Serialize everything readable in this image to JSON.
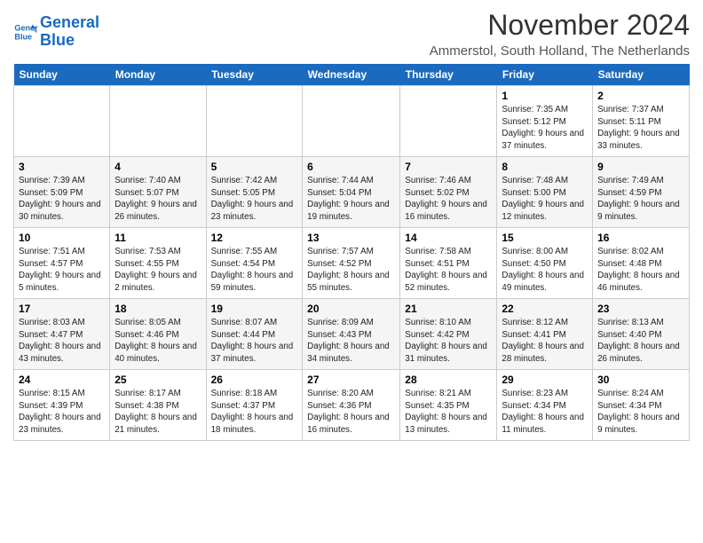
{
  "header": {
    "logo_line1": "General",
    "logo_line2": "Blue",
    "month": "November 2024",
    "location": "Ammerstol, South Holland, The Netherlands"
  },
  "weekdays": [
    "Sunday",
    "Monday",
    "Tuesday",
    "Wednesday",
    "Thursday",
    "Friday",
    "Saturday"
  ],
  "weeks": [
    [
      {
        "day": "",
        "info": ""
      },
      {
        "day": "",
        "info": ""
      },
      {
        "day": "",
        "info": ""
      },
      {
        "day": "",
        "info": ""
      },
      {
        "day": "",
        "info": ""
      },
      {
        "day": "1",
        "info": "Sunrise: 7:35 AM\nSunset: 5:12 PM\nDaylight: 9 hours and 37 minutes."
      },
      {
        "day": "2",
        "info": "Sunrise: 7:37 AM\nSunset: 5:11 PM\nDaylight: 9 hours and 33 minutes."
      }
    ],
    [
      {
        "day": "3",
        "info": "Sunrise: 7:39 AM\nSunset: 5:09 PM\nDaylight: 9 hours and 30 minutes."
      },
      {
        "day": "4",
        "info": "Sunrise: 7:40 AM\nSunset: 5:07 PM\nDaylight: 9 hours and 26 minutes."
      },
      {
        "day": "5",
        "info": "Sunrise: 7:42 AM\nSunset: 5:05 PM\nDaylight: 9 hours and 23 minutes."
      },
      {
        "day": "6",
        "info": "Sunrise: 7:44 AM\nSunset: 5:04 PM\nDaylight: 9 hours and 19 minutes."
      },
      {
        "day": "7",
        "info": "Sunrise: 7:46 AM\nSunset: 5:02 PM\nDaylight: 9 hours and 16 minutes."
      },
      {
        "day": "8",
        "info": "Sunrise: 7:48 AM\nSunset: 5:00 PM\nDaylight: 9 hours and 12 minutes."
      },
      {
        "day": "9",
        "info": "Sunrise: 7:49 AM\nSunset: 4:59 PM\nDaylight: 9 hours and 9 minutes."
      }
    ],
    [
      {
        "day": "10",
        "info": "Sunrise: 7:51 AM\nSunset: 4:57 PM\nDaylight: 9 hours and 5 minutes."
      },
      {
        "day": "11",
        "info": "Sunrise: 7:53 AM\nSunset: 4:55 PM\nDaylight: 9 hours and 2 minutes."
      },
      {
        "day": "12",
        "info": "Sunrise: 7:55 AM\nSunset: 4:54 PM\nDaylight: 8 hours and 59 minutes."
      },
      {
        "day": "13",
        "info": "Sunrise: 7:57 AM\nSunset: 4:52 PM\nDaylight: 8 hours and 55 minutes."
      },
      {
        "day": "14",
        "info": "Sunrise: 7:58 AM\nSunset: 4:51 PM\nDaylight: 8 hours and 52 minutes."
      },
      {
        "day": "15",
        "info": "Sunrise: 8:00 AM\nSunset: 4:50 PM\nDaylight: 8 hours and 49 minutes."
      },
      {
        "day": "16",
        "info": "Sunrise: 8:02 AM\nSunset: 4:48 PM\nDaylight: 8 hours and 46 minutes."
      }
    ],
    [
      {
        "day": "17",
        "info": "Sunrise: 8:03 AM\nSunset: 4:47 PM\nDaylight: 8 hours and 43 minutes."
      },
      {
        "day": "18",
        "info": "Sunrise: 8:05 AM\nSunset: 4:46 PM\nDaylight: 8 hours and 40 minutes."
      },
      {
        "day": "19",
        "info": "Sunrise: 8:07 AM\nSunset: 4:44 PM\nDaylight: 8 hours and 37 minutes."
      },
      {
        "day": "20",
        "info": "Sunrise: 8:09 AM\nSunset: 4:43 PM\nDaylight: 8 hours and 34 minutes."
      },
      {
        "day": "21",
        "info": "Sunrise: 8:10 AM\nSunset: 4:42 PM\nDaylight: 8 hours and 31 minutes."
      },
      {
        "day": "22",
        "info": "Sunrise: 8:12 AM\nSunset: 4:41 PM\nDaylight: 8 hours and 28 minutes."
      },
      {
        "day": "23",
        "info": "Sunrise: 8:13 AM\nSunset: 4:40 PM\nDaylight: 8 hours and 26 minutes."
      }
    ],
    [
      {
        "day": "24",
        "info": "Sunrise: 8:15 AM\nSunset: 4:39 PM\nDaylight: 8 hours and 23 minutes."
      },
      {
        "day": "25",
        "info": "Sunrise: 8:17 AM\nSunset: 4:38 PM\nDaylight: 8 hours and 21 minutes."
      },
      {
        "day": "26",
        "info": "Sunrise: 8:18 AM\nSunset: 4:37 PM\nDaylight: 8 hours and 18 minutes."
      },
      {
        "day": "27",
        "info": "Sunrise: 8:20 AM\nSunset: 4:36 PM\nDaylight: 8 hours and 16 minutes."
      },
      {
        "day": "28",
        "info": "Sunrise: 8:21 AM\nSunset: 4:35 PM\nDaylight: 8 hours and 13 minutes."
      },
      {
        "day": "29",
        "info": "Sunrise: 8:23 AM\nSunset: 4:34 PM\nDaylight: 8 hours and 11 minutes."
      },
      {
        "day": "30",
        "info": "Sunrise: 8:24 AM\nSunset: 4:34 PM\nDaylight: 8 hours and 9 minutes."
      }
    ]
  ]
}
